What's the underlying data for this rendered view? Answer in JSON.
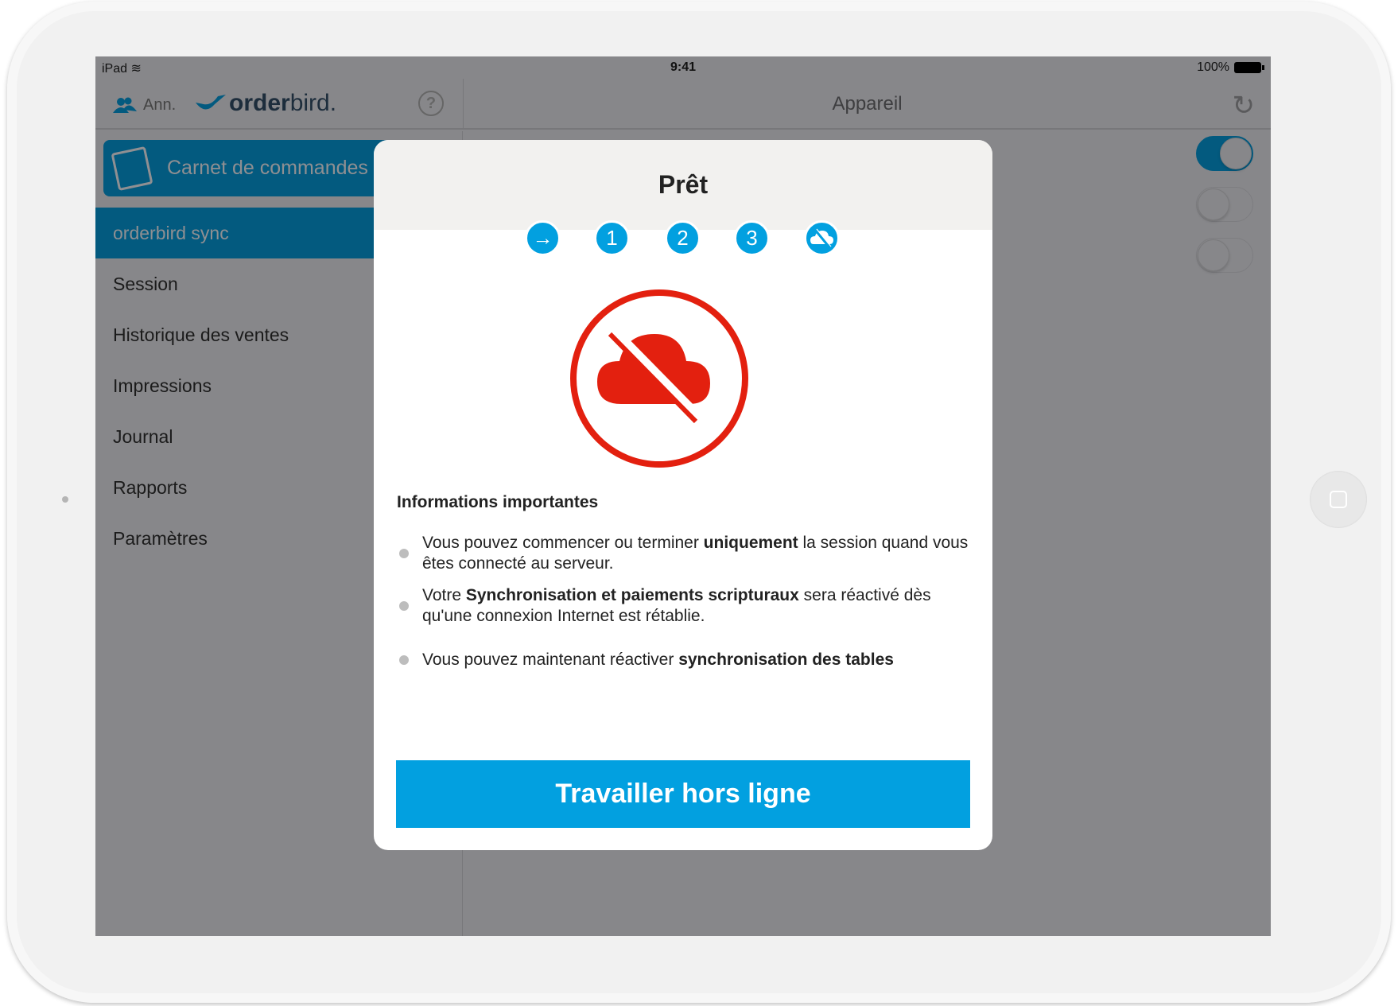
{
  "status_bar": {
    "device": "iPad",
    "time": "9:41",
    "battery": "100%"
  },
  "header": {
    "user_label": "Ann.",
    "logo_bold": "order",
    "logo_light": "bird.",
    "right_title": "Appareil"
  },
  "sidebar": {
    "notebook": "Carnet de commandes",
    "items": [
      {
        "label": "orderbird sync",
        "selected": true
      },
      {
        "label": "Session"
      },
      {
        "label": "Historique des ventes"
      },
      {
        "label": "Impressions"
      },
      {
        "label": "Journal"
      },
      {
        "label": "Rapports"
      },
      {
        "label": "Paramètres"
      }
    ]
  },
  "toggles": [
    {
      "on": true
    },
    {
      "on": false
    },
    {
      "on": false
    }
  ],
  "modal": {
    "title": "Prêt",
    "steps": [
      {
        "icon": "arrow-right-icon",
        "label": ""
      },
      {
        "label": "1"
      },
      {
        "label": "2"
      },
      {
        "label": "3"
      },
      {
        "icon": "cloud-off-icon",
        "label": ""
      }
    ],
    "status_icon": "cloud-off-icon",
    "status_color": "#e3200f",
    "accent_color": "#02a0e0",
    "info_heading": "Informations importantes",
    "bullets": [
      {
        "a": "Vous pouvez commencer ou terminer ",
        "b": "uniquement",
        "c": " la session quand vous êtes connecté au serveur."
      },
      {
        "a": "Votre ",
        "b": "Synchronisation et paiements scripturaux",
        "c": " sera réactivé dès qu'une connexion Internet est rétablie."
      },
      {
        "a": "Vous pouvez maintenant réactiver ",
        "b": "synchronisation des tables",
        "c": ""
      }
    ],
    "button": "Travailler hors ligne"
  }
}
